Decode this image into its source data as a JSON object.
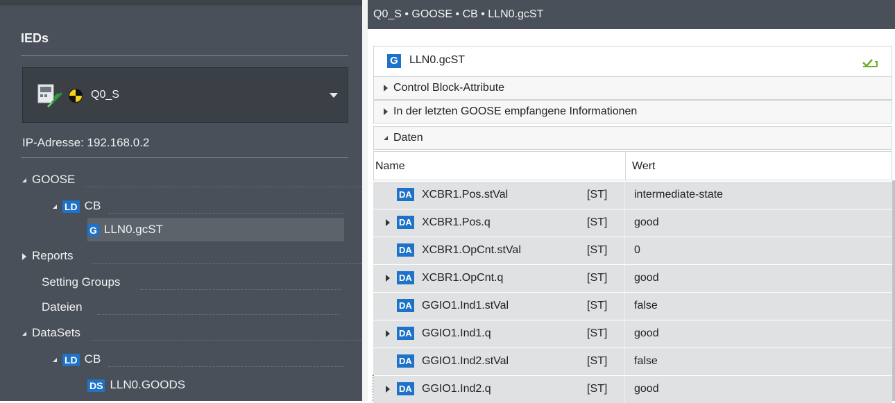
{
  "left": {
    "title": "IEDs",
    "ied_name": "Q0_S",
    "ip_label": "IP-Adresse: 192.168.0.2",
    "tree": [
      {
        "label": "GOOSE"
      },
      {
        "badge": "LD",
        "label": "CB"
      },
      {
        "badge": "G",
        "label": "LLN0.gcST"
      },
      {
        "label": "Reports"
      },
      {
        "label": "Setting Groups"
      },
      {
        "label": "Dateien"
      },
      {
        "label": "DataSets"
      },
      {
        "badge": "LD",
        "label": "CB"
      },
      {
        "badge": "DS",
        "label": "LLN0.GOODS"
      }
    ]
  },
  "right": {
    "breadcrumb": "Q0_S • GOOSE • CB • LLN0.gcST",
    "panel_badge": "G",
    "panel_title": "LLN0.gcST",
    "sections": [
      "Control Block-Attribute",
      "In der letzten GOOSE empfangene Informationen",
      "Daten"
    ],
    "columns": {
      "name": "Name",
      "value": "Wert"
    },
    "rows": [
      {
        "badge": "DA",
        "name": "XCBR1.Pos.stVal",
        "fc": "[ST]",
        "value": "intermediate-state"
      },
      {
        "badge": "DA",
        "name": "XCBR1.Pos.q",
        "fc": "[ST]",
        "value": "good"
      },
      {
        "badge": "DA",
        "name": "XCBR1.OpCnt.stVal",
        "fc": "[ST]",
        "value": "0"
      },
      {
        "badge": "DA",
        "name": "XCBR1.OpCnt.q",
        "fc": "[ST]",
        "value": "good"
      },
      {
        "badge": "DA",
        "name": "GGIO1.Ind1.stVal",
        "fc": "[ST]",
        "value": "false"
      },
      {
        "badge": "DA",
        "name": "GGIO1.Ind1.q",
        "fc": "[ST]",
        "value": "good"
      },
      {
        "badge": "DA",
        "name": "GGIO1.Ind2.stVal",
        "fc": "[ST]",
        "value": "false"
      },
      {
        "badge": "DA",
        "name": "GGIO1.Ind2.q",
        "fc": "[ST]",
        "value": "good"
      }
    ]
  },
  "colors": {
    "panel_dark": "#4a5059",
    "badge_blue": "#1e73c8",
    "row_gray": "#dfe1e3",
    "check_green": "#6ab023"
  }
}
